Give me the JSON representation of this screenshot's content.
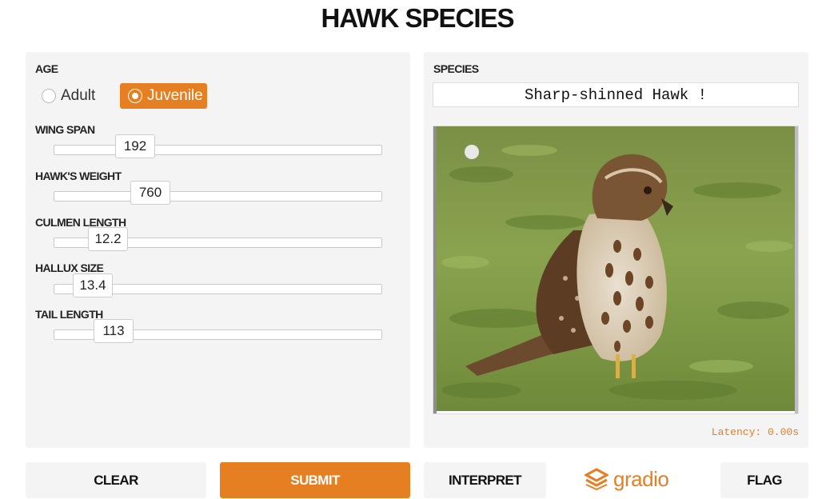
{
  "title": "HAWK SPECIES",
  "inputs": {
    "age": {
      "label": "AGE",
      "options": [
        "Adult",
        "Juvenile"
      ],
      "selected": "Juvenile"
    },
    "sliders": [
      {
        "label": "WING SPAN",
        "value": "192"
      },
      {
        "label": "HAWK'S WEIGHT",
        "value": "760"
      },
      {
        "label": "CULMEN LENGTH",
        "value": "12.2"
      },
      {
        "label": "HALLUX SIZE",
        "value": "13.4"
      },
      {
        "label": "TAIL LENGTH",
        "value": "113"
      }
    ]
  },
  "output": {
    "label": "SPECIES",
    "value": "Sharp-shinned Hawk !",
    "image_icon": "hawk-photo",
    "latency": "Latency: 0.00s"
  },
  "buttons": {
    "clear": "CLEAR",
    "submit": "SUBMIT",
    "interpret": "INTERPRET",
    "flag": "FLAG"
  },
  "branding": {
    "logo_text": "gradio",
    "logo_icon": "gradio-logo-icon"
  },
  "colors": {
    "accent": "#e67e22",
    "panel_bg": "#f4f4f4"
  }
}
